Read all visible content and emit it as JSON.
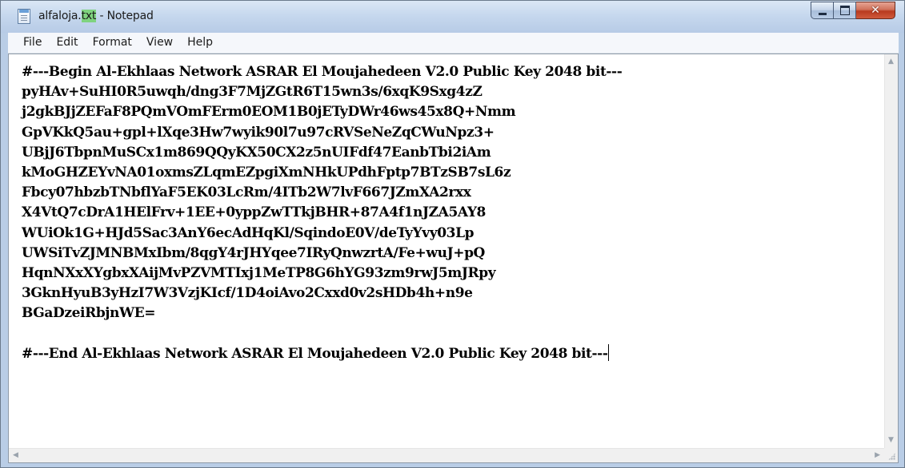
{
  "window": {
    "title_prefix": "alfaloja.",
    "title_ext": "txt",
    "title_suffix": " - Notepad",
    "minimize_glyph": "minimize",
    "maximize_glyph": "maximize",
    "close_glyph": "✕"
  },
  "menu": {
    "file": "File",
    "edit": "Edit",
    "format": "Format",
    "view": "View",
    "help": "Help"
  },
  "editor": {
    "lines": [
      "#---Begin Al-Ekhlaas Network ASRAR El Moujahedeen V2.0 Public Key 2048 bit---",
      "pyHAv+SuHI0R5uwqh/dng3F7MjZGtR6T15wn3s/6xqK9Sxg4zZ",
      "j2gkBJjZEFaF8PQmVOmFErm0EOM1B0jETyDWr46ws45x8Q+Nmm",
      "GpVKkQ5au+gpl+lXqe3Hw7wyik90l7u97cRVSeNeZqCWuNpz3+",
      "UBjJ6TbpnMuSCx1m869QQyKX50CX2z5nUIFdf47EanbTbi2iAm",
      "kMoGHZEYvNA01oxmsZLqmEZpgiXmNHkUPdhFptp7BTzSB7sL6z",
      "Fbcy07hbzbTNbflYaF5EK03LcRm/4ITb2W7lvF667JZmXA2rxx",
      "X4VtQ7cDrA1HElFrv+1EE+0yppZwTTkjBHR+87A4f1nJZA5AY8",
      "WUiOk1G+HJd5Sac3AnY6ecAdHqKl/SqindoE0V/deTyYvy03Lp",
      "UWSiTvZJMNBMxIbm/8qgY4rJHYqee7IRyQnwzrtA/Fe+wuJ+pQ",
      "HqnNXxXYgbxXAijMvPZVMTIxj1MeTP8G6hYG93zm9rwJ5mJRpy",
      "3GknHyuB3yHzI7W3VzjKIcf/1D4oiAvo2Cxxd0v2sHDb4h+n9e",
      "BGaDzeiRbjnWE=",
      "",
      "#---End Al-Ekhlaas Network ASRAR El Moujahedeen V2.0 Public Key 2048 bit---"
    ]
  },
  "scrollbars": {
    "up_arrow": "▲",
    "down_arrow": "▼",
    "left_arrow": "◀",
    "right_arrow": "▶"
  }
}
